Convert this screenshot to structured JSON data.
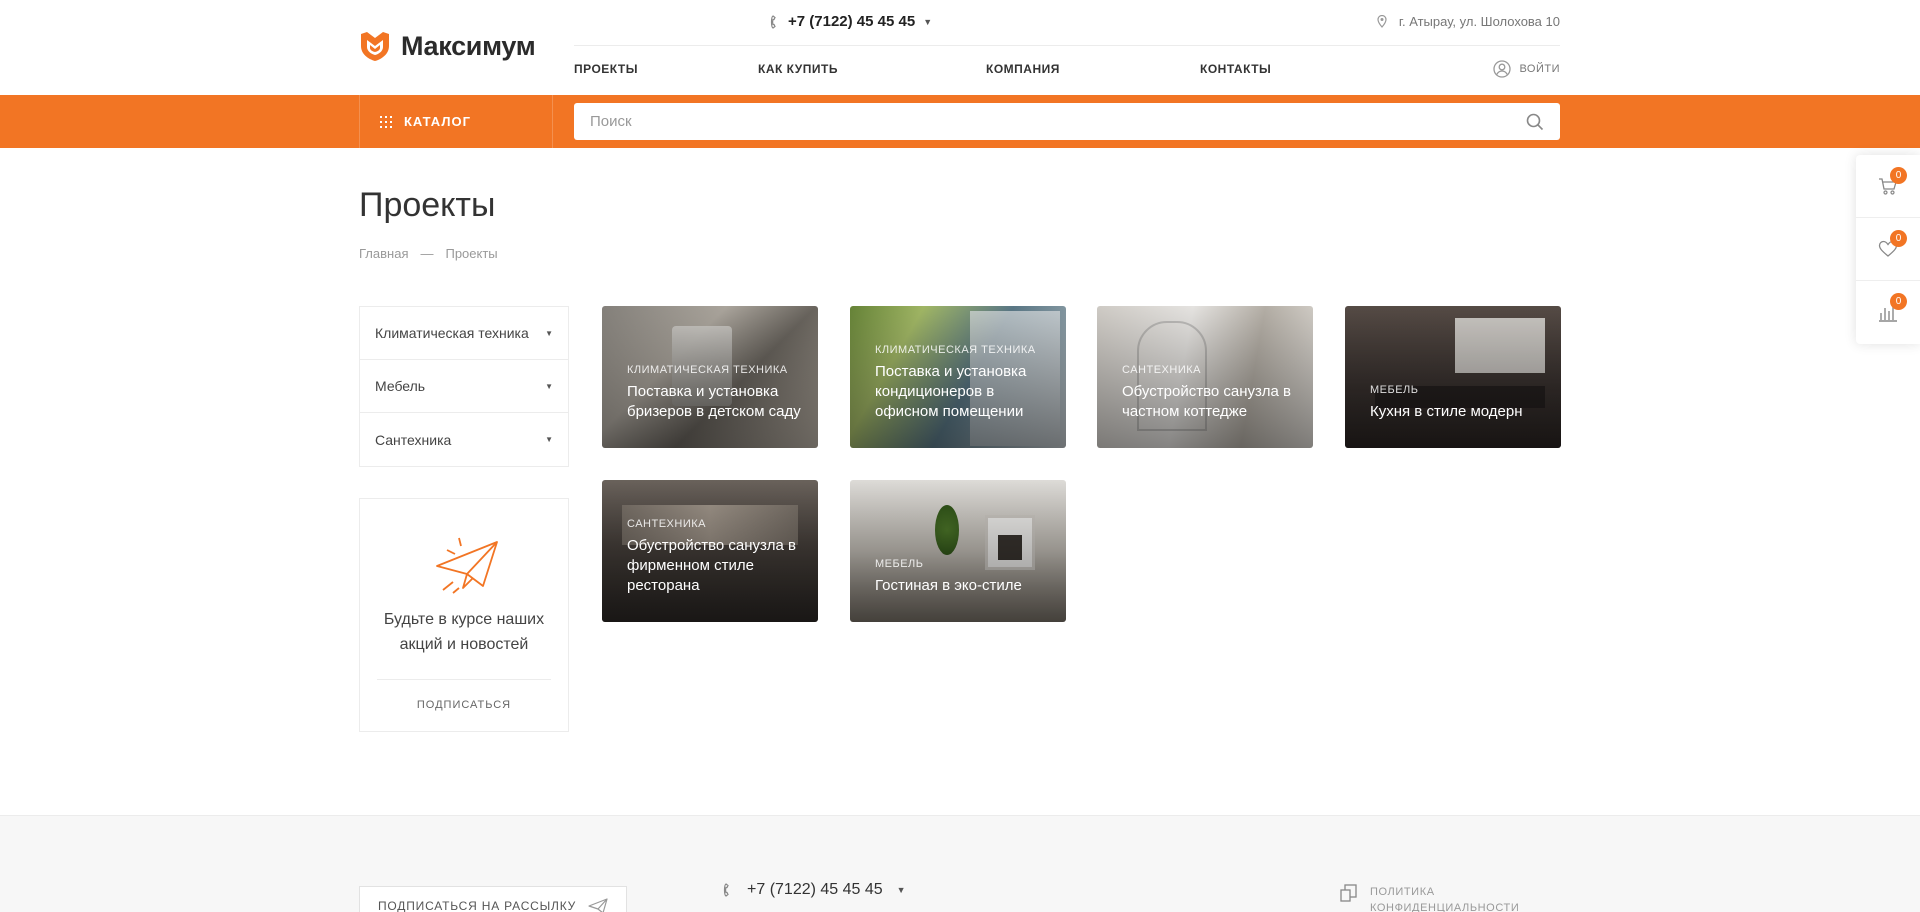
{
  "header": {
    "logo_text": "Максимум",
    "phone": "+7 (7122) 45 45 45",
    "address": "г. Атырау, ул. Шолохова 10",
    "nav": [
      "ПРОЕКТЫ",
      "КАК КУПИТЬ",
      "КОМПАНИЯ",
      "КОНТАКТЫ"
    ],
    "login": "ВОЙТИ"
  },
  "bar": {
    "catalog": "КАТАЛОГ",
    "search_placeholder": "Поиск"
  },
  "float_panel": {
    "cart_count": "0",
    "favorites_count": "0",
    "compare_count": "0"
  },
  "page": {
    "title": "Проекты",
    "breadcrumbs": [
      "Главная",
      "—",
      "Проекты"
    ]
  },
  "sidebar": {
    "items": [
      {
        "label": "Климатическая техника"
      },
      {
        "label": "Мебель"
      },
      {
        "label": "Сантехника"
      }
    ],
    "subscribe_text": "Будьте в курсе наших акций и новостей",
    "subscribe_link": "ПОДПИСАТЬСЯ"
  },
  "projects": [
    {
      "category": "Климатическая техника",
      "title": "Поставка и установка бризеров в детском саду"
    },
    {
      "category": "Климатическая техника",
      "title": "Поставка и установка кондиционеров в офисном помещении"
    },
    {
      "category": "Сантехника",
      "title": "Обустройство санузла в частном коттедже"
    },
    {
      "category": "Мебель",
      "title": "Кухня в стиле модерн"
    },
    {
      "category": "Сантехника",
      "title": "Обустройство санузла в фирменном стиле ресторана"
    },
    {
      "category": "Мебель",
      "title": "Гостиная в эко-стиле"
    }
  ],
  "footer": {
    "subscribe": "ПОДПИСАТЬСЯ НА РАССЫЛКУ",
    "phone": "+7 (7122) 45 45 45",
    "policy_line1": "ПОЛИТИКА",
    "policy_line2": "КОНФИДЕНЦИАЛЬНОСТИ"
  },
  "colors": {
    "accent": "#f27524"
  },
  "icons": {
    "logo": "logo-icon",
    "phone": "phone-icon",
    "location": "location-pin-icon",
    "user": "user-icon",
    "catalog": "grid-icon",
    "search": "search-icon",
    "cart": "cart-icon",
    "favorites": "heart-icon",
    "compare": "compare-icon",
    "plane": "paper-plane-icon",
    "policy": "document-icon"
  }
}
